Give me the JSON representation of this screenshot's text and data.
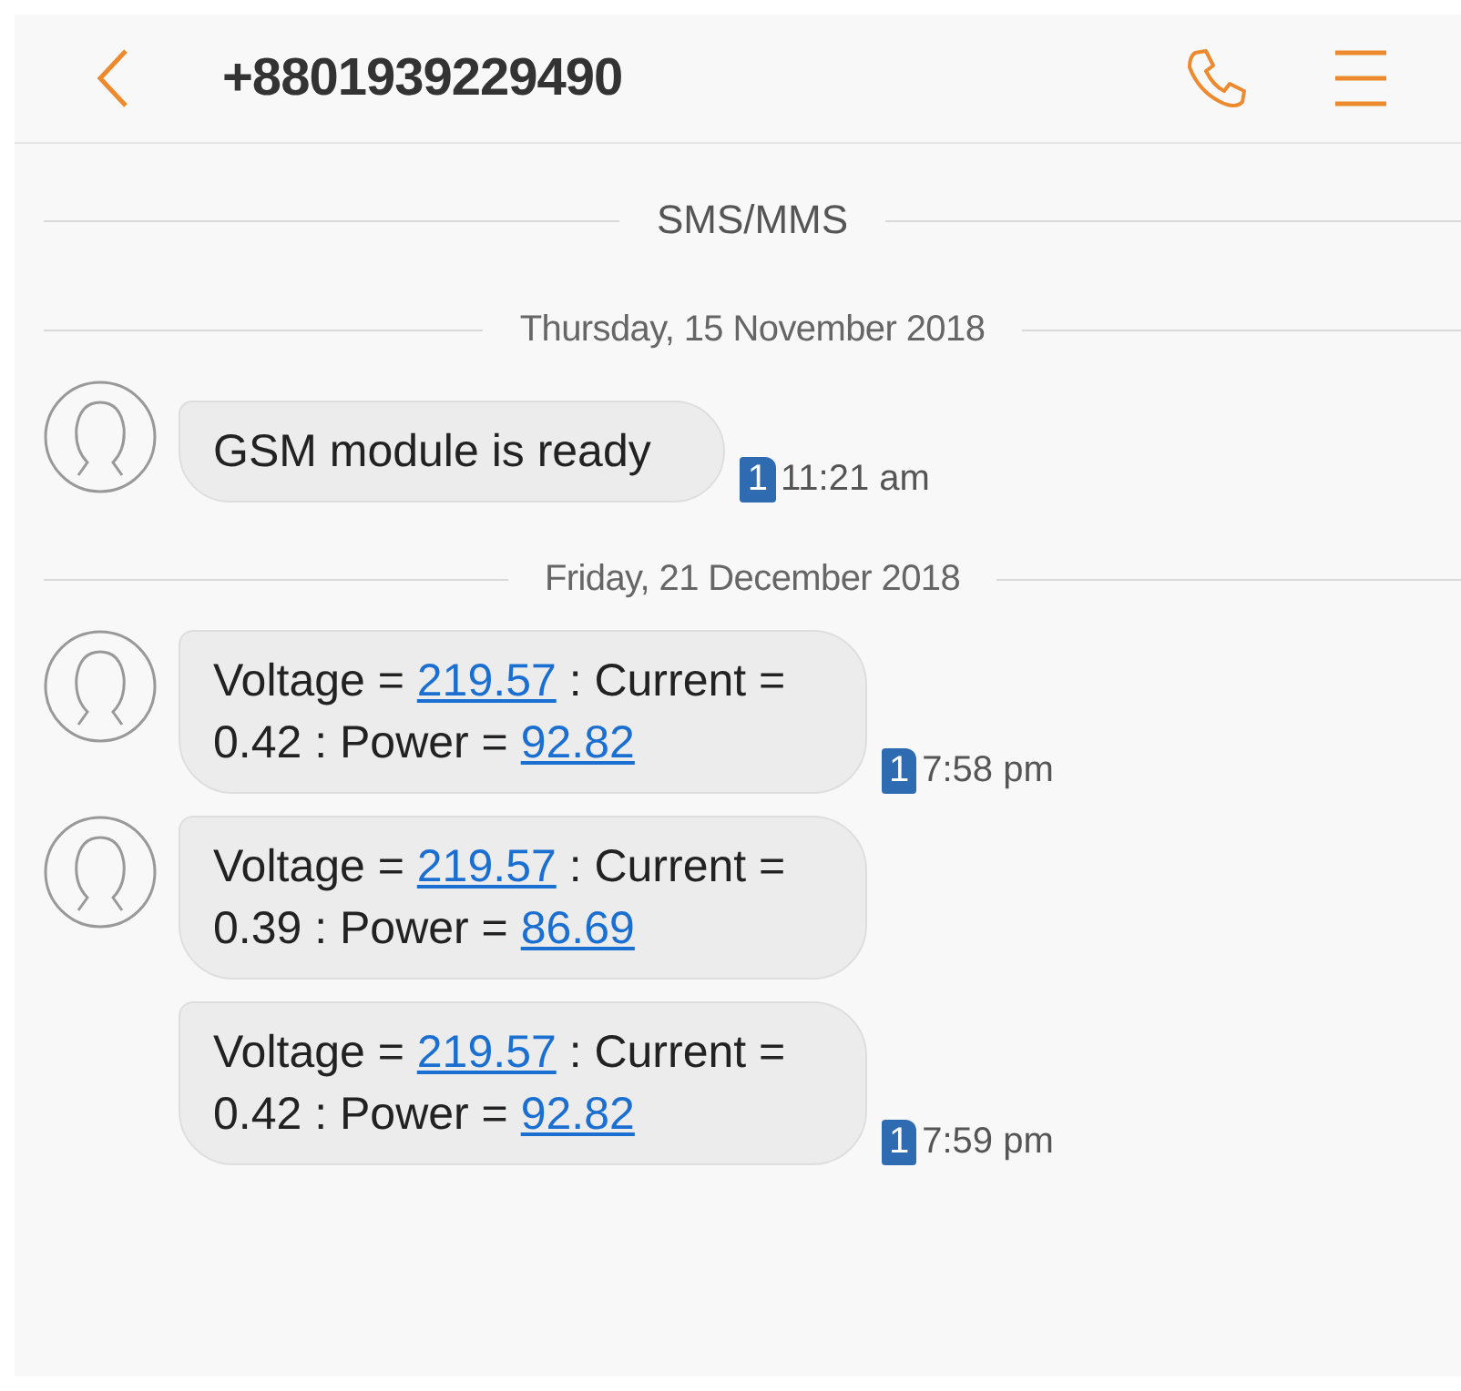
{
  "header": {
    "title": "+8801939229490"
  },
  "items": [
    {
      "kind": "divider",
      "label": "SMS/MMS"
    },
    {
      "kind": "date",
      "label": "Thursday, 15 November 2018"
    },
    {
      "kind": "message",
      "avatar": true,
      "parts": [
        {
          "kind": "text",
          "text": "GSM module is ready"
        }
      ],
      "sim": "1",
      "time": "11:21 am"
    },
    {
      "kind": "date",
      "label": "Friday, 21 December 2018"
    },
    {
      "kind": "message",
      "avatar": true,
      "parts": [
        {
          "kind": "text",
          "text": "Voltage = "
        },
        {
          "kind": "link",
          "text": "219.57"
        },
        {
          "kind": "text",
          "text": " : Current = 0.42 : Power = "
        },
        {
          "kind": "link",
          "text": "92.82"
        }
      ],
      "sim": "1",
      "time": "7:58 pm"
    },
    {
      "kind": "message",
      "avatar": true,
      "parts": [
        {
          "kind": "text",
          "text": "Voltage = "
        },
        {
          "kind": "link",
          "text": "219.57"
        },
        {
          "kind": "text",
          "text": " : Current = 0.39 : Power = "
        },
        {
          "kind": "link",
          "text": "86.69"
        }
      ]
    },
    {
      "kind": "message",
      "avatar": false,
      "parts": [
        {
          "kind": "text",
          "text": "Voltage = "
        },
        {
          "kind": "link",
          "text": "219.57"
        },
        {
          "kind": "text",
          "text": " : Current = 0.42 : Power = "
        },
        {
          "kind": "link",
          "text": "92.82"
        }
      ],
      "sim": "1",
      "time": "7:59 pm"
    }
  ]
}
